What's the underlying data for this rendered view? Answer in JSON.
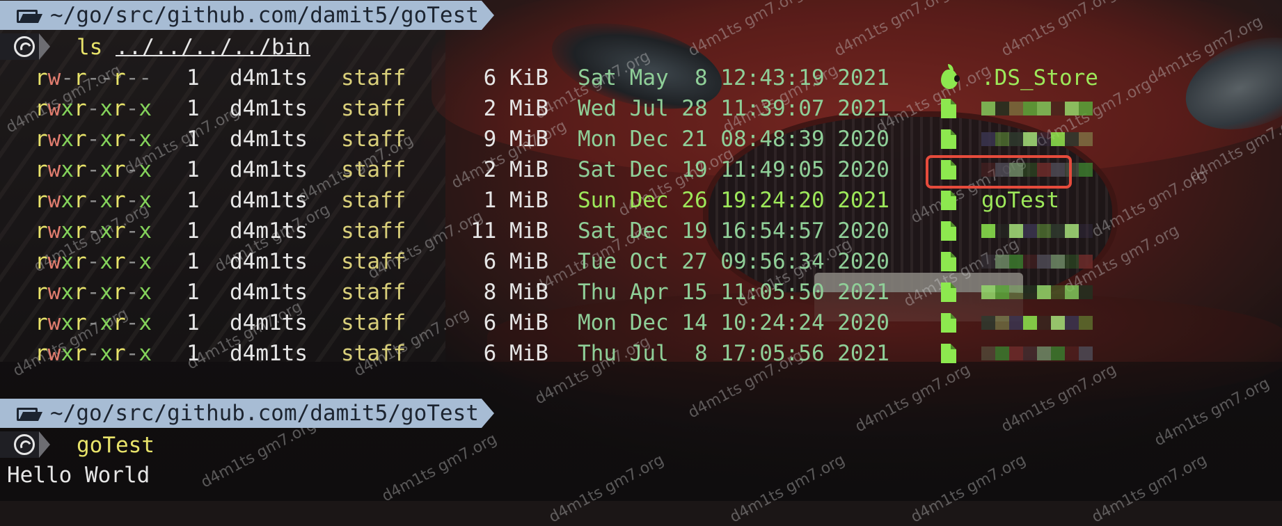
{
  "session_1": {
    "path": "~/go/src/github.com/damit5/goTest",
    "command": "ls",
    "argument": "../../../../bin"
  },
  "listing_columns": [
    "permissions",
    "links",
    "owner",
    "group",
    "size",
    "date",
    "icon",
    "name"
  ],
  "listing": [
    {
      "perm": "rw-r--r--",
      "links": "1",
      "owner": "d4m1ts",
      "group": "staff",
      "size": "6 KiB",
      "date": "Sat May  8 12:43:19 2021",
      "icon": "apple-icon",
      "name": ".DS_Store",
      "name_redacted": false,
      "highlighted": false
    },
    {
      "perm": "rwxr-xr-x",
      "links": "1",
      "owner": "d4m1ts",
      "group": "staff",
      "size": "2 MiB",
      "date": "Wed Jul 28 11:39:07 2021",
      "icon": "file-icon",
      "name": "",
      "name_redacted": true,
      "highlighted": false
    },
    {
      "perm": "rwxr-xr-x",
      "links": "1",
      "owner": "d4m1ts",
      "group": "staff",
      "size": "9 MiB",
      "date": "Mon Dec 21 08:48:39 2020",
      "icon": "file-icon",
      "name": "",
      "name_redacted": true,
      "highlighted": false
    },
    {
      "perm": "rwxr-xr-x",
      "links": "1",
      "owner": "d4m1ts",
      "group": "staff",
      "size": "2 MiB",
      "date": "Sat Dec 19 11:49:05 2020",
      "icon": "file-icon",
      "name": "",
      "name_redacted": true,
      "highlighted": false
    },
    {
      "perm": "rwxr-xr-x",
      "links": "1",
      "owner": "d4m1ts",
      "group": "staff",
      "size": "1 MiB",
      "date": "Sun Dec 26 19:24:20 2021",
      "icon": "file-icon",
      "name": "goTest",
      "name_redacted": false,
      "highlighted": true
    },
    {
      "perm": "rwxr-xr-x",
      "links": "1",
      "owner": "d4m1ts",
      "group": "staff",
      "size": "11 MiB",
      "date": "Sat Dec 19 16:54:57 2020",
      "icon": "file-icon",
      "name": "",
      "name_redacted": true,
      "highlighted": false
    },
    {
      "perm": "rwxr-xr-x",
      "links": "1",
      "owner": "d4m1ts",
      "group": "staff",
      "size": "6 MiB",
      "date": "Tue Oct 27 09:56:34 2020",
      "icon": "file-icon",
      "name": "",
      "name_redacted": true,
      "highlighted": false
    },
    {
      "perm": "rwxr-xr-x",
      "links": "1",
      "owner": "d4m1ts",
      "group": "staff",
      "size": "8 MiB",
      "date": "Thu Apr 15 11:05:50 2021",
      "icon": "file-icon",
      "name": "",
      "name_redacted": true,
      "highlighted": false
    },
    {
      "perm": "rwxr-xr-x",
      "links": "1",
      "owner": "d4m1ts",
      "group": "staff",
      "size": "6 MiB",
      "date": "Mon Dec 14 10:24:24 2020",
      "icon": "file-icon",
      "name": "",
      "name_redacted": true,
      "highlighted": false
    },
    {
      "perm": "rwxr-xr-x",
      "links": "1",
      "owner": "d4m1ts",
      "group": "staff",
      "size": "6 MiB",
      "date": "Thu Jul  8 17:05:56 2021",
      "icon": "file-icon",
      "name": "",
      "name_redacted": true,
      "highlighted": false
    }
  ],
  "session_2": {
    "path": "~/go/src/github.com/damit5/goTest",
    "command": "goTest",
    "output": "Hello World"
  },
  "watermark_text": "d4m1ts gm7.org",
  "colors": {
    "path_bar": "#a7bcd4",
    "read": "#e8e36a",
    "write": "#e27d6f",
    "exec": "#84d35b",
    "date": "#8fcf98",
    "filename": "#9de85a",
    "highlight_border": "#e64b3c"
  }
}
